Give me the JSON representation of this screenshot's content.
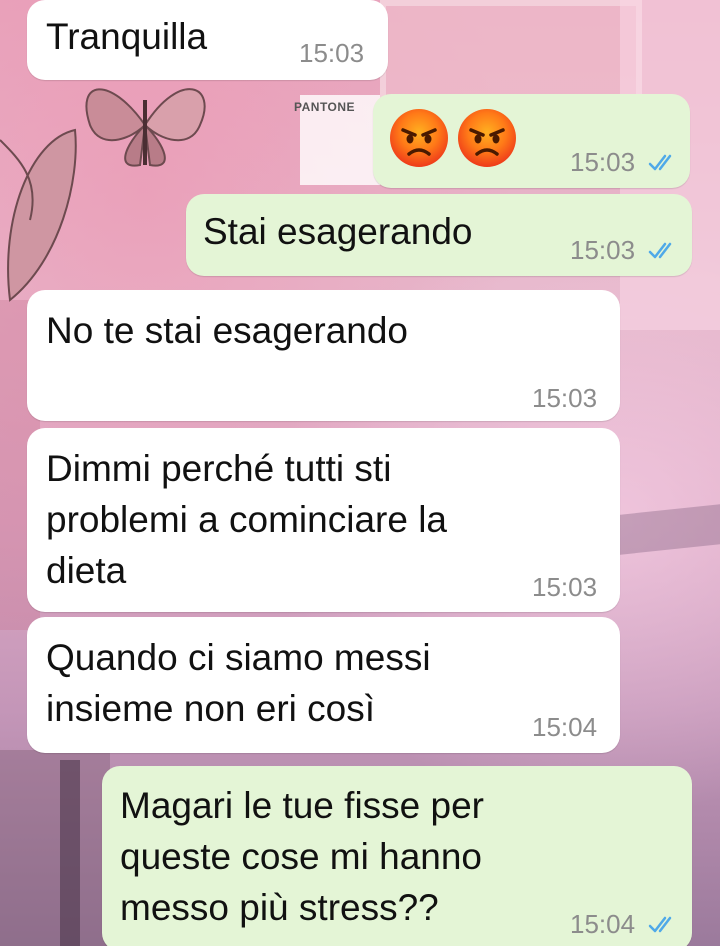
{
  "conversation": {
    "messages": [
      {
        "direction": "incoming",
        "text": "Tranquilla",
        "time": "15:03"
      },
      {
        "direction": "outgoing",
        "emoji": [
          "angry-face",
          "angry-face"
        ],
        "time": "15:03",
        "status": "read"
      },
      {
        "direction": "outgoing",
        "text": "Stai esagerando",
        "time": "15:03",
        "status": "read"
      },
      {
        "direction": "incoming",
        "text": "No te stai esagerando",
        "time": "15:03"
      },
      {
        "direction": "incoming",
        "lines": [
          "Dimmi perché tutti sti",
          "problemi a cominciare la",
          "dieta"
        ],
        "time": "15:03"
      },
      {
        "direction": "incoming",
        "lines": [
          "Quando ci siamo messi",
          "insieme non eri così"
        ],
        "time": "15:04"
      },
      {
        "direction": "outgoing",
        "lines": [
          "Magari le tue fisse per",
          "queste cose mi hanno",
          "messo più stress??"
        ],
        "time": "15:04",
        "status": "read"
      }
    ]
  },
  "wallpaper": {
    "pantone_label": "PANTONE"
  },
  "colors": {
    "incoming_bubble": "#ffffff",
    "outgoing_bubble": "#e4f5d6",
    "read_ticks": "#4fa9e8",
    "timestamp": "#8c8c8c"
  }
}
